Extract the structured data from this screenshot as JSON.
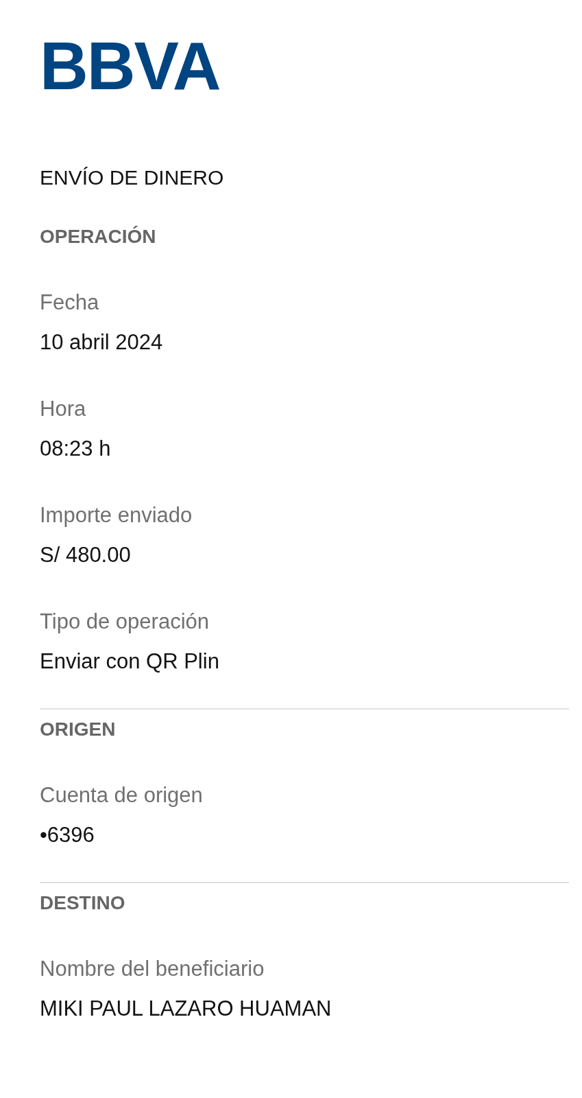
{
  "logo": {
    "text": "BBVA"
  },
  "title": "ENVÍO DE DINERO",
  "sections": [
    {
      "heading": "OPERACIÓN",
      "fields": [
        {
          "label": "Fecha",
          "value": "10 abril 2024"
        },
        {
          "label": "Hora",
          "value": "08:23 h"
        },
        {
          "label": "Importe enviado",
          "value": "S/ 480.00"
        },
        {
          "label": "Tipo de operación",
          "value": "Enviar con QR Plin"
        }
      ]
    },
    {
      "heading": "ORIGEN",
      "fields": [
        {
          "label": "Cuenta de origen",
          "value": "•6396"
        }
      ]
    },
    {
      "heading": "DESTINO",
      "fields": [
        {
          "label": "Nombre del beneficiario",
          "value": "MIKI PAUL LAZARO HUAMAN"
        }
      ]
    }
  ]
}
